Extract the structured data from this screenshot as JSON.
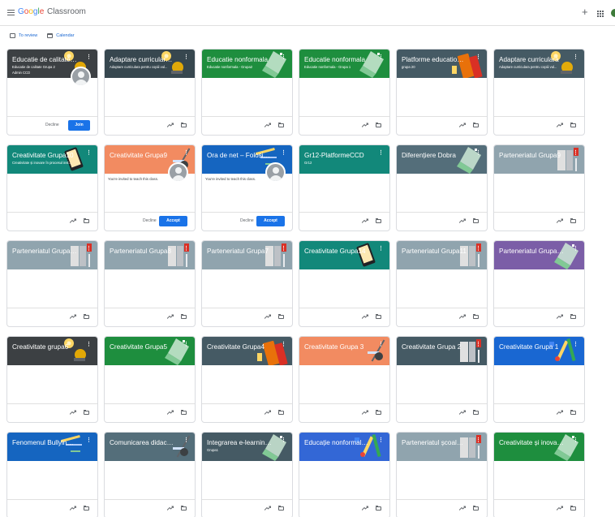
{
  "app": {
    "logo_google": "Google",
    "logo_product": "Classroom",
    "icons": {
      "menu": "menu-icon",
      "add": "plus-icon",
      "apps": "apps-grid-icon",
      "account": "account-avatar"
    },
    "account_color": "#3e7b3a"
  },
  "subnav": {
    "to_review": "To review",
    "calendar": "Calendar"
  },
  "colors": {
    "accent": "#1a73e8"
  },
  "cards": [
    {
      "title": "Educatie de calitate p...",
      "subtitle": "Educatie de calitate Grupa 2",
      "subtitle2": "Admin CCD",
      "color": "#3c4043",
      "illus": "bulb",
      "state": "invite-join",
      "decline": "Decline",
      "action": "Join"
    },
    {
      "title": "Adaptare curriculara ...",
      "subtitle": "Adaptare curriculara pentru copiii vul...",
      "color": "#37474f",
      "illus": "bulb"
    },
    {
      "title": "Educatie nonformala",
      "subtitle": "Educatie nonformala - Grupa2",
      "color": "#1e8e3e",
      "illus": "cube"
    },
    {
      "title": "Educatie nonformala",
      "subtitle": "Educatie nonformala - Grupa 1",
      "color": "#1e8e3e",
      "illus": "cube"
    },
    {
      "title": "Platforme educationa...",
      "subtitle": "grupa 20",
      "color": "#455a64",
      "illus": "books"
    },
    {
      "title": "Adaptare curriculara",
      "subtitle": "Adaptare curriculara pentru copiii vul...",
      "color": "#455a64",
      "illus": "bulb"
    },
    {
      "title": "Creativitate Grupa10",
      "subtitle": "Creativitate și inovare în procesul inst...",
      "color": "#12887a",
      "illus": "tablet"
    },
    {
      "title": "Creativitate Grupa9",
      "color": "#f28b61",
      "illus": "tools",
      "state": "invite-accept",
      "invite": "You're invited to teach this class.",
      "decline": "Decline",
      "action": "Accept"
    },
    {
      "title": "Ora de net – Folosire...",
      "color": "#1565c0",
      "illus": "pen",
      "state": "invite-accept",
      "invite": "You're invited to teach this class.",
      "decline": "Decline",
      "action": "Accept"
    },
    {
      "title": "Gr12-PlatformeCCD",
      "subtitle": "Gr12",
      "color": "#12887a",
      "illus": "none"
    },
    {
      "title": "Diferențiere Dobra",
      "color": "#546e7a",
      "illus": "cube"
    },
    {
      "title": "Parteneriatul Grupa9",
      "color": "#90a4ae",
      "illus": "school"
    },
    {
      "title": "Parteneriatul Grupa13",
      "color": "#90a4ae",
      "illus": "school"
    },
    {
      "title": "Parteneriatul Grupa8",
      "color": "#90a4ae",
      "illus": "school"
    },
    {
      "title": "Parteneriatul Grupa7",
      "color": "#90a4ae",
      "illus": "school"
    },
    {
      "title": "Creativitate Grupa14",
      "color": "#12887a",
      "illus": "tablet"
    },
    {
      "title": "Parteneriatul Grupa11",
      "color": "#90a4ae",
      "illus": "school"
    },
    {
      "title": "Parteneriatul Grupa12",
      "color": "#7b5ea7",
      "illus": "cube"
    },
    {
      "title": "Creativitate grupa6",
      "color": "#3c4043",
      "illus": "bulb"
    },
    {
      "title": "Creativitate Grupa5",
      "color": "#1e8e3e",
      "illus": "cube"
    },
    {
      "title": "Creativitate Grupa4",
      "color": "#455a64",
      "illus": "books"
    },
    {
      "title": "Creativitate Grupa 3",
      "color": "#f28b61",
      "illus": "tools"
    },
    {
      "title": "Creativitate Grupa 2",
      "color": "#455a64",
      "illus": "school"
    },
    {
      "title": "Creativitate Grupa 1",
      "color": "#1967d2",
      "illus": "pencils"
    },
    {
      "title": "Fenomenul Bullying -...",
      "color": "#1565c0",
      "illus": "pen"
    },
    {
      "title": "Comunicarea didacti...",
      "color": "#546e7a",
      "illus": "tools"
    },
    {
      "title": "Integrarea e-learning...",
      "subtitle": "Grupa1",
      "color": "#455a64",
      "illus": "cube"
    },
    {
      "title": "Educație nonformală ...",
      "color": "#3367d6",
      "illus": "pencils"
    },
    {
      "title": "Parteneriatul școala, ...",
      "color": "#90a4ae",
      "illus": "school"
    },
    {
      "title": "Creativitate și inovar...",
      "color": "#1e8e3e",
      "illus": "cube"
    }
  ]
}
